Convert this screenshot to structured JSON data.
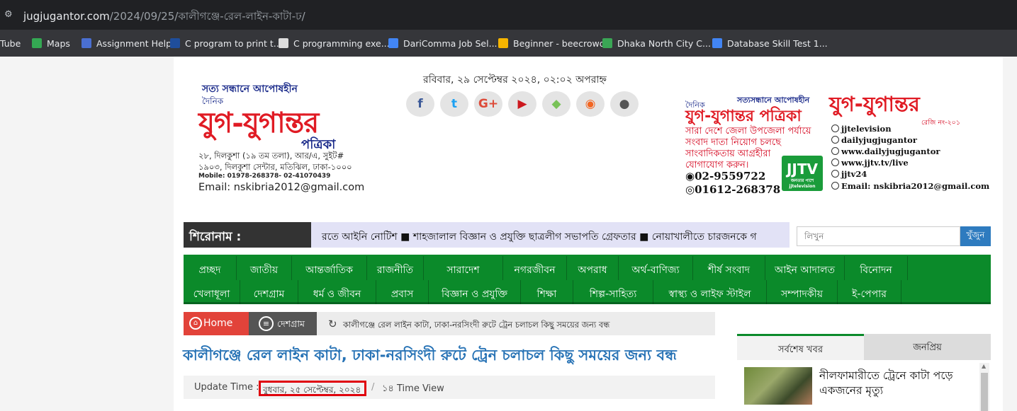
{
  "browser": {
    "url_host": "jugjugantor.com",
    "url_path": "/2024/09/25/কালীগঞ্জে-রেল-লাইন-কাটা-ঢ/",
    "bookmarks": [
      {
        "label": "Tube",
        "icon": "youtube-icon",
        "color": "#ff0000"
      },
      {
        "label": "Maps",
        "icon": "maps-icon",
        "color": "#34a853"
      },
      {
        "label": "Assignment Help",
        "icon": "assignment-icon",
        "color": "#4a6fd1"
      },
      {
        "label": "C program to print t...",
        "icon": "graduation-cap-icon",
        "color": "#1f4e9c"
      },
      {
        "label": "C programming exe...",
        "icon": "w3-icon",
        "color": "#dddddd"
      },
      {
        "label": "DariComma Job Sel...",
        "icon": "docs-icon",
        "color": "#4285f4"
      },
      {
        "label": "Beginner - beecrowd",
        "icon": "beecrowd-icon",
        "color": "#f5b400"
      },
      {
        "label": "Dhaka North City C...",
        "icon": "dncc-icon",
        "color": "#3aa655"
      },
      {
        "label": "Database Skill Test 1...",
        "icon": "docs-icon",
        "color": "#4285f4"
      }
    ]
  },
  "header": {
    "logo": {
      "tagline": "সত্য সন্ধানে আপোষহীন",
      "dainik": "দৈনিক",
      "title": "যুগ-যুগান্তর",
      "patrika": "পত্রিকা",
      "address1": "২৮, দিলকুশা (১৯ তম তলা), আর/এ, সুইট#",
      "address2": "১৯০৩, দিলকুশা সেন্টার, মতিঝিল, ঢাকা-১০০০",
      "mobile": "Mobile: 01978-268378- 02-41070439",
      "email": "Email: nskibria2012@gmail.com"
    },
    "date": "রবিবার, ২৯ সেপ্টেম্বর ২০২৪, ০২:০২ অপরাহ্ন",
    "social": [
      {
        "name": "facebook-icon",
        "glyph": "f",
        "color": "#3b5998"
      },
      {
        "name": "twitter-icon",
        "glyph": "t",
        "color": "#1da1f2"
      },
      {
        "name": "google-plus-icon",
        "glyph": "G+",
        "color": "#dd4b39"
      },
      {
        "name": "youtube-icon",
        "glyph": "▶",
        "color": "#cc181e"
      },
      {
        "name": "android-icon",
        "glyph": "◆",
        "color": "#78c257"
      },
      {
        "name": "rss-icon",
        "glyph": "◉",
        "color": "#f26522"
      },
      {
        "name": "apple-icon",
        "glyph": "●",
        "color": "#555555"
      }
    ],
    "ad": {
      "dainik": "দৈনিক",
      "tagline": "সত্যসন্ধানে আপোষহীন",
      "name": "যুগ-যুগান্তর পত্রিকা",
      "lines": [
        "সারা দেশে জেলা উপজেলা পর্যায়ে",
        "সংবাদ দাতা নিয়োগ চলছে",
        "সাংবাদিকতায় আগ্রহীরা",
        "যোগাযোগ করুন।"
      ],
      "phone1": "02-9559722",
      "phone2": "01612-268378",
      "tv_logo": "JJTV",
      "tv_sub": "জনতার পাশে jjtelevision",
      "brand": "যুগ-যুগান্তর",
      "reg": "রেজি নং-২০১",
      "contacts": [
        "jjtelevision",
        "dailyjugjugantor",
        "www.dailyjugjugantor",
        "www.jjtv.tv/live",
        "jjtv24",
        "Email: nskibria2012@gmail.com"
      ]
    }
  },
  "ticker": {
    "label": "শিরোনাম :",
    "text": "রতে আইনি নোটিশ ■ শাহজালাল বিজ্ঞান ও প্রযুক্তি ছাত্রলীগ সভাপতি গ্রেফতার ■ নোয়াখালীতে চারজনকে গ"
  },
  "search": {
    "placeholder": "লিখুন",
    "button": "খুঁজুন"
  },
  "menu": {
    "row1": [
      "প্রচ্ছদ",
      "জাতীয়",
      "আন্তর্জাতিক",
      "রাজনীতি",
      "সারাদেশ",
      "নগরজীবন",
      "অপরাধ",
      "অর্থ-বাণিজ্য",
      "শীর্ষ সংবাদ",
      "আইন আদালত",
      "বিনোদন"
    ],
    "row2": [
      "খেলাধূলা",
      "দেশগ্রাম",
      "ধর্ম ও জীবন",
      "প্রবাস",
      "বিজ্ঞান ও প্রযুক্তি",
      "শিক্ষা",
      "শিল্প-সাহিত্য",
      "স্বাস্থ্য ও লাইফ স্টাইল",
      "সম্পাদকীয়",
      "ই-পেপার"
    ]
  },
  "breadcrumb": {
    "home": "Home",
    "category": "দেশগ্রাম",
    "current": "কালীগঞ্জে রেল লাইন কাটা, ঢাকা-নরসিংদী রুটে   ট্রেন চলাচল কিছু সময়ের জন্য বন্ধ"
  },
  "article": {
    "title": "কালীগঞ্জে রেল লাইন কাটা, ঢাকা-নরসিংদী রুটে   ট্রেন চলাচল কিছু সময়ের জন্য বন্ধ",
    "update_label": "Update Time :",
    "update_date": "বুধবার, ২৫ সেপ্টেম্বর, ২০২৪",
    "separator": "/",
    "views": "১৪ Time View"
  },
  "sidebar": {
    "tab_latest": "সর্বশেষ খবর",
    "tab_popular": "জনপ্রিয়",
    "items": [
      {
        "title": "নীলফামারীতে ট্রেনে কাটা পড়ে একজনের মৃত্যু"
      }
    ]
  },
  "colors": {
    "brand_red": "#e01b24",
    "menu_green": "#0b8a2a",
    "title_blue": "#2672b5",
    "highlight_red": "#e0000d"
  }
}
